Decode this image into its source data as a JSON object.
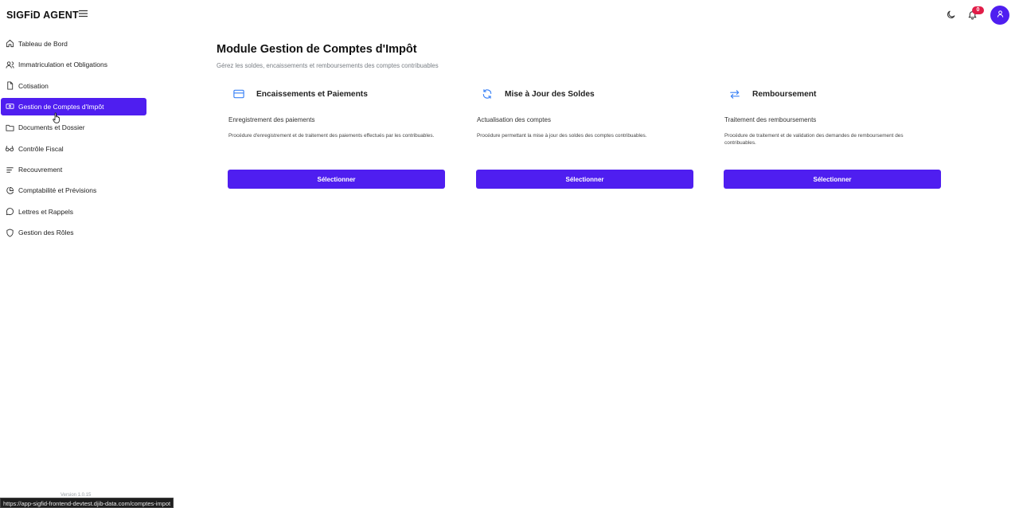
{
  "app": {
    "brand": "SIGFiD AGENT"
  },
  "header": {
    "notification_count": "0",
    "accent": "#4f1ef0",
    "badge_color": "#e11d48"
  },
  "sidebar": {
    "items": [
      {
        "label": "Tableau de Bord",
        "icon": "home-icon"
      },
      {
        "label": "Immatriculation et Obligations",
        "icon": "users-icon"
      },
      {
        "label": "Cotisation",
        "icon": "document-icon"
      },
      {
        "label": "Gestion de Comptes d'Impôt",
        "icon": "banknote-icon",
        "active": true
      },
      {
        "label": "Documents et Dossier",
        "icon": "folder-icon"
      },
      {
        "label": "Contrôle Fiscal",
        "icon": "glasses-icon"
      },
      {
        "label": "Recouvrement",
        "icon": "list-icon"
      },
      {
        "label": "Comptabilité et Prévisions",
        "icon": "pie-chart-icon"
      },
      {
        "label": "Lettres et Rappels",
        "icon": "message-icon"
      },
      {
        "label": "Gestion des Rôles",
        "icon": "shield-icon"
      }
    ],
    "version": "Version 1.0.15"
  },
  "status_bar": {
    "url": "https://app-sigfid-frontend-devtest.djib-data.com/comptes-impot"
  },
  "main": {
    "title": "Module Gestion de Comptes d'Impôt",
    "subtitle": "Gérez les soldes, encaissements et remboursements des comptes contribuables",
    "cards": [
      {
        "icon": "credit-card-icon",
        "title": "Encaissements et Paiements",
        "subtitle": "Enregistrement des paiements",
        "description": "Procédure d'enregistrement et de traitement des paiements effectués par les contribuables.",
        "button": "Sélectionner"
      },
      {
        "icon": "refresh-icon",
        "title": "Mise à Jour des Soldes",
        "subtitle": "Actualisation des comptes",
        "description": "Procédure permettant la mise à jour des soldes des comptes contribuables.",
        "button": "Sélectionner"
      },
      {
        "icon": "arrows-exchange-icon",
        "title": "Remboursement",
        "subtitle": "Traitement des remboursements",
        "description": "Procédure de traitement et de validation des demandes de remboursement des contribuables.",
        "button": "Sélectionner"
      }
    ]
  }
}
